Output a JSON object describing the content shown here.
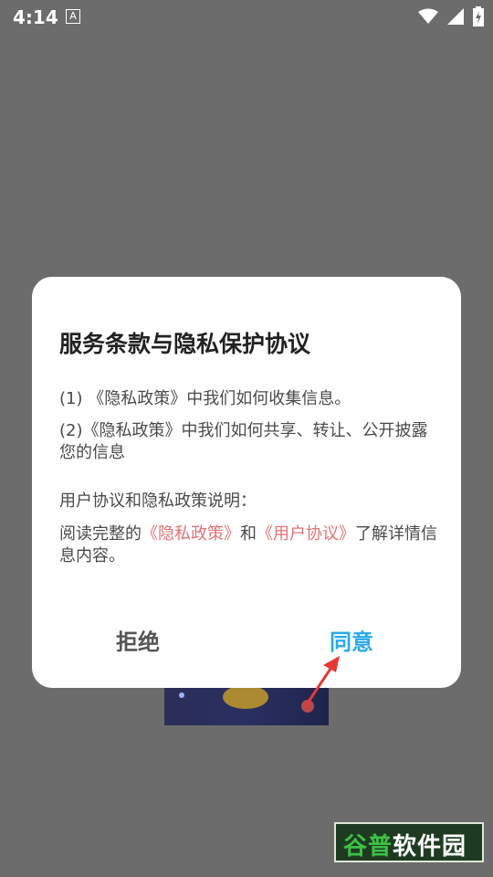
{
  "statusbar": {
    "time": "4:14",
    "a_icon": "A",
    "icons": [
      "wifi-icon",
      "signal-icon",
      "battery-icon"
    ]
  },
  "dialog": {
    "title": "服务条款与隐私保护协议",
    "line1": {
      "prefix": "(1) 《隐私政策》中我们如何收集信息。"
    },
    "line2": "(2)《隐私政策》中我们如何共享、转让、公开披露您的信息",
    "line3": "用户协议和隐私政策说明：",
    "line4": {
      "pre": "阅读完整的",
      "link1": "《隐私政策》",
      "mid": "和",
      "link2": "《用户协议》",
      "post": "了解详情信息内容。"
    },
    "reject_label": "拒绝",
    "agree_label": "同意"
  },
  "watermark": {
    "brand_green": "谷普",
    "brand_white": "软件园"
  },
  "colors": {
    "overlay": "#6c6c6c",
    "agree": "#28a9ee",
    "link": "#e07278",
    "arrow": "#e53935"
  }
}
